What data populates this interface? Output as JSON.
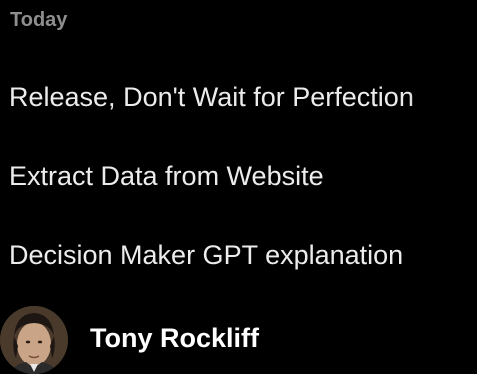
{
  "sidebar": {
    "section_header": "Today",
    "history": [
      {
        "title": "Release, Don't Wait for Perfection"
      },
      {
        "title": "Extract Data from Website"
      },
      {
        "title": "Decision Maker GPT explanation"
      }
    ]
  },
  "user": {
    "name": "Tony Rockliff",
    "avatar_icon": "user-avatar-photo"
  },
  "colors": {
    "background": "#000000",
    "section_header": "#8e8e8e",
    "item_text": "#ececec",
    "user_name": "#ffffff"
  }
}
